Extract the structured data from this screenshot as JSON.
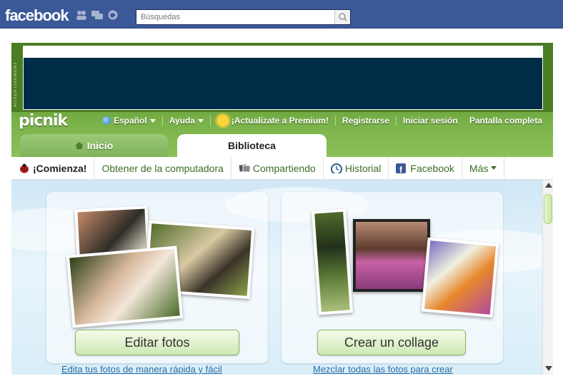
{
  "facebook": {
    "logo": "facebook",
    "search_placeholder": "Búsquedas",
    "icons": [
      "friends-icon",
      "messages-icon",
      "notifications-icon"
    ]
  },
  "ad": {
    "label": "ADVERTISEMENT"
  },
  "picnik": {
    "logo": "picnik",
    "nav": {
      "language": "Español",
      "help": "Ayuda",
      "premium": "¡Actualízate a Premium!",
      "register": "Registrarse",
      "login": "Iniciar sesión",
      "fullscreen": "Pantalla completa"
    },
    "tabs": {
      "home": "Inicio",
      "library": "Biblioteca"
    },
    "subnav": [
      {
        "label": "¡Comienza!"
      },
      {
        "label": "Obtener de la computadora"
      },
      {
        "label": "Compartiendo"
      },
      {
        "label": "Historial"
      },
      {
        "label": "Facebook"
      },
      {
        "label": "Más"
      }
    ],
    "cards": {
      "edit": {
        "button": "Editar fotos",
        "desc": "Edita tus fotos de manera rápida y fácil"
      },
      "collage": {
        "button": "Crear un collage",
        "desc": "Mezclar todas las fotos para crear"
      }
    }
  }
}
